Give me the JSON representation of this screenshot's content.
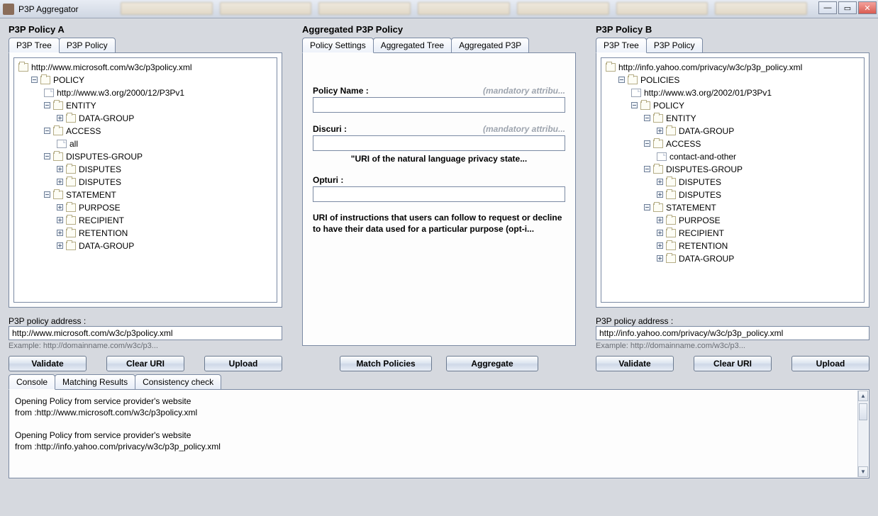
{
  "window": {
    "title": "P3P Aggregator"
  },
  "policyA": {
    "header": "P3P Policy A",
    "tabs": {
      "tree": "P3P Tree",
      "policy": "P3P Policy"
    },
    "tree": {
      "root": "http://www.microsoft.com/w3c/p3policy.xml",
      "policy": "POLICY",
      "policyVersion": "http://www.w3.org/2000/12/P3Pv1",
      "entity": "ENTITY",
      "dataGroup": "DATA-GROUP",
      "access": "ACCESS",
      "accessAll": "all",
      "disputesGroup": "DISPUTES-GROUP",
      "disputes": "DISPUTES",
      "statement": "STATEMENT",
      "purpose": "PURPOSE",
      "recipient": "RECIPIENT",
      "retention": "RETENTION"
    },
    "addrLabel": "P3P policy address :",
    "addr": "http://www.microsoft.com/w3c/p3policy.xml",
    "example": "Example: http://domainname.com/w3c/p3...",
    "buttons": {
      "validate": "Validate",
      "clear": "Clear URI",
      "upload": "Upload"
    }
  },
  "aggregated": {
    "header": "Aggregated P3P Policy",
    "tabs": {
      "settings": "Policy Settings",
      "tree": "Aggregated Tree",
      "p3p": "Aggregated P3P"
    },
    "fields": {
      "policyName": {
        "label": "Policy Name :",
        "hint": "(mandatory attribu...",
        "value": ""
      },
      "discuri": {
        "label": "Discuri :",
        "hint": "(mandatory attribu...",
        "value": "",
        "sub": "\"URI of the natural language privacy state..."
      },
      "opturi": {
        "label": "Opturi :",
        "value": ""
      }
    },
    "desc": "URI of instructions that users can follow to request\nor decline to have their data used for a particular purpose (opt-i...",
    "buttons": {
      "match": "Match Policies",
      "aggregate": "Aggregate"
    }
  },
  "policyB": {
    "header": "P3P Policy B",
    "tabs": {
      "tree": "P3P Tree",
      "policy": "P3P Policy"
    },
    "tree": {
      "root": "http://info.yahoo.com/privacy/w3c/p3p_policy.xml",
      "policies": "POLICIES",
      "policiesVersion": "http://www.w3.org/2002/01/P3Pv1",
      "policy": "POLICY",
      "entity": "ENTITY",
      "dataGroup": "DATA-GROUP",
      "access": "ACCESS",
      "accessItem": "contact-and-other",
      "disputesGroup": "DISPUTES-GROUP",
      "disputes": "DISPUTES",
      "statement": "STATEMENT",
      "purpose": "PURPOSE",
      "recipient": "RECIPIENT",
      "retention": "RETENTION"
    },
    "addrLabel": "P3P policy address :",
    "addr": "http://info.yahoo.com/privacy/w3c/p3p_policy.xml",
    "example": "Example: http://domainname.com/w3c/p3...",
    "buttons": {
      "validate": "Validate",
      "clear": "Clear URI",
      "upload": "Upload"
    }
  },
  "bottom": {
    "tabs": {
      "console": "Console",
      "matching": "Matching Results",
      "consistency": "Consistency check"
    },
    "console": "Opening Policy from service provider's website\nfrom  :http://www.microsoft.com/w3c/p3policy.xml\n\nOpening Policy from service provider's website\nfrom  :http://info.yahoo.com/privacy/w3c/p3p_policy.xml"
  }
}
